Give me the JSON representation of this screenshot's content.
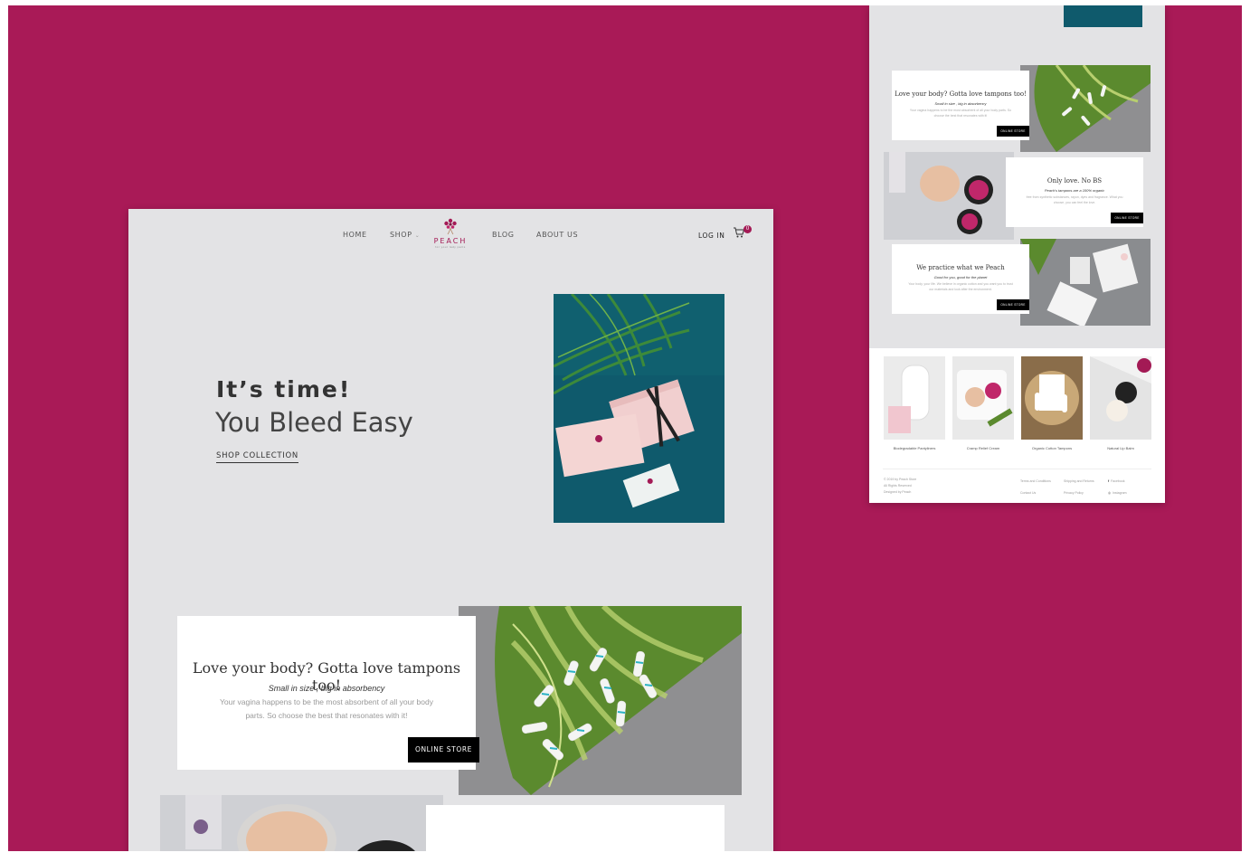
{
  "colors": {
    "brand": "#a31a55",
    "background_magenta": "#a91a57",
    "page_gray": "#e3e3e5",
    "button_black": "#000000",
    "teal": "#0f5a6c"
  },
  "main": {
    "nav": {
      "home": "HOME",
      "shop": "SHOP",
      "shop_chevron": "⌄",
      "blog": "BLOG",
      "about": "ABOUT US",
      "logo_word": "PEACH",
      "logo_tag": "for your lady parts",
      "login": "LOG IN",
      "cart_count": "0"
    },
    "hero": {
      "small_title": "It’s time!",
      "large_title": "You Bleed Easy",
      "cta": "SHOP COLLECTION"
    },
    "feature1": {
      "title": "Love your body? Gotta love tampons too!",
      "subtitle": "Small in size , big in absorbency",
      "body": "Your vagina happens to be the most absorbent of all your body parts. So choose the best that resonates with it!",
      "button": "ONLINE STORE"
    }
  },
  "right": {
    "feature1": {
      "title": "Love your body? Gotta love tampons too!",
      "subtitle": "Small in size , big in absorbency",
      "body": "Your vagina happens to be the most absorbent of all your body parts. So choose the best that resonates with it!",
      "button": "ONLINE STORE"
    },
    "feature2": {
      "title": "Only love. No BS",
      "subtitle": "Peach's tampons are a 100% organic",
      "body": "free from synthetic substances, rayon, dyes and fragrance. What you choose, you can feel the love.",
      "button": "ONLINE STORE"
    },
    "feature3": {
      "title": "We practice what we Peach",
      "subtitle": "Good for you, good for the planet",
      "body": "Your body, your life. We believe in organic cotton and you want you to trust our materials and look after the environment.",
      "button": "ONLINE STORE"
    },
    "products": [
      {
        "label": "Biodegradable Pantyliners"
      },
      {
        "label": "Cramp Relief Cream"
      },
      {
        "label": "Organic Cotton Tampons"
      },
      {
        "label": "Natural Lip Balm"
      }
    ],
    "footer": {
      "copyright": "© 2019 by Peach Store",
      "rights": "All Rights Reserved",
      "credit": "Designed by Peach",
      "terms": "Terms and Conditions",
      "contact": "Contact Us",
      "shipping": "Shipping and Returns",
      "privacy": "Privacy Policy",
      "facebook": "Facebook",
      "instagram": "Instagram"
    }
  }
}
